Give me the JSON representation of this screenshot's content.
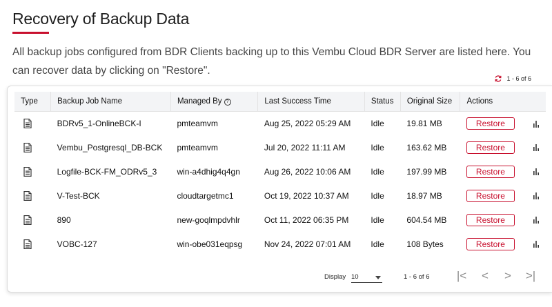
{
  "page": {
    "title": "Recovery of Backup Data",
    "description": "All backup jobs configured from BDR Clients backing up to this Vembu Cloud BDR Server are listed here. You can recover data by clicking on \"Restore\".",
    "accent_color": "#c8102e"
  },
  "pager": {
    "summary": "1 - 6 of 6",
    "display_label": "Display",
    "display_value": "10"
  },
  "table": {
    "headers": {
      "type": "Type",
      "name": "Backup Job Name",
      "managed": "Managed By",
      "last": "Last Success Time",
      "status": "Status",
      "size": "Original Size",
      "actions": "Actions"
    },
    "restore_label": "Restore",
    "rows": [
      {
        "name": "BDRv5_1-OnlineBCK-I",
        "managed": "pmteamvm",
        "last": "Aug 25, 2022 05:29 AM",
        "status": "Idle",
        "size": "19.81 MB"
      },
      {
        "name": "Vembu_Postgresql_DB-BCK",
        "managed": "pmteamvm",
        "last": "Jul 20, 2022 11:11 AM",
        "status": "Idle",
        "size": "163.62 MB"
      },
      {
        "name": "Logfile-BCK-FM_ODRv5_3",
        "managed": "win-a4dhig4q4gn",
        "last": "Aug 26, 2022 10:06 AM",
        "status": "Idle",
        "size": "197.99 MB"
      },
      {
        "name": "V-Test-BCK",
        "managed": "cloudtargetmc1",
        "last": "Oct 19, 2022 10:37 AM",
        "status": "Idle",
        "size": "18.97 MB"
      },
      {
        "name": "890",
        "managed": "new-goqlmpdvhlr",
        "last": "Oct 11, 2022 06:35 PM",
        "status": "Idle",
        "size": "604.54 MB"
      },
      {
        "name": "VOBC-127",
        "managed": "win-obe031eqpsg",
        "last": "Nov 24, 2022 07:01 AM",
        "status": "Idle",
        "size": "108 Bytes"
      }
    ]
  }
}
